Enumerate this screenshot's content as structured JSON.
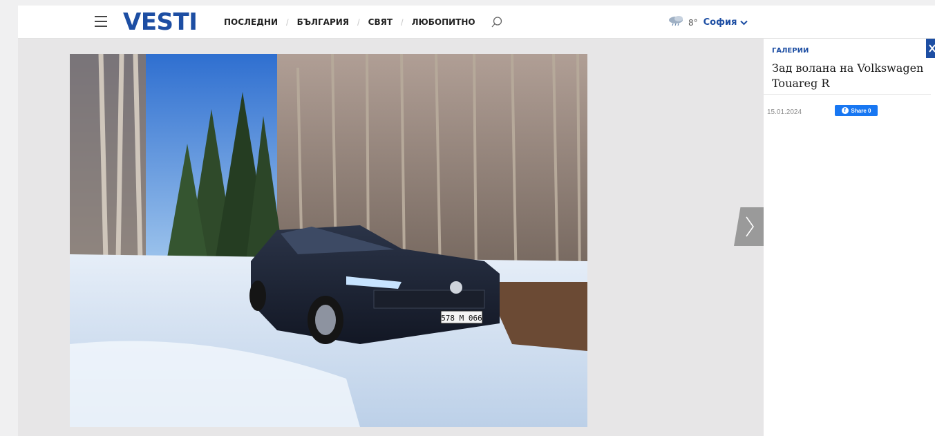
{
  "header": {
    "logo": "VESTI",
    "nav": [
      {
        "label": "ПОСЛЕДНИ"
      },
      {
        "label": "БЪЛГАРИЯ"
      },
      {
        "label": "СВЯТ"
      },
      {
        "label": "ЛЮБОПИТНО"
      }
    ],
    "separator": "/",
    "weather": {
      "icon": "cloud-rain-icon",
      "temp": "8°",
      "city": "София"
    }
  },
  "gallery": {
    "photo_alt": "Volkswagen Touareg R in a snowy forest",
    "plate": "578 M 066"
  },
  "sidebar": {
    "category": "ГАЛЕРИИ",
    "title": "Зад волана на Volkswagen Touareg R",
    "date": "15.01.2024",
    "share_label": "Share 0"
  },
  "colors": {
    "brand": "#1d4ea3",
    "facebook": "#1877f2"
  }
}
